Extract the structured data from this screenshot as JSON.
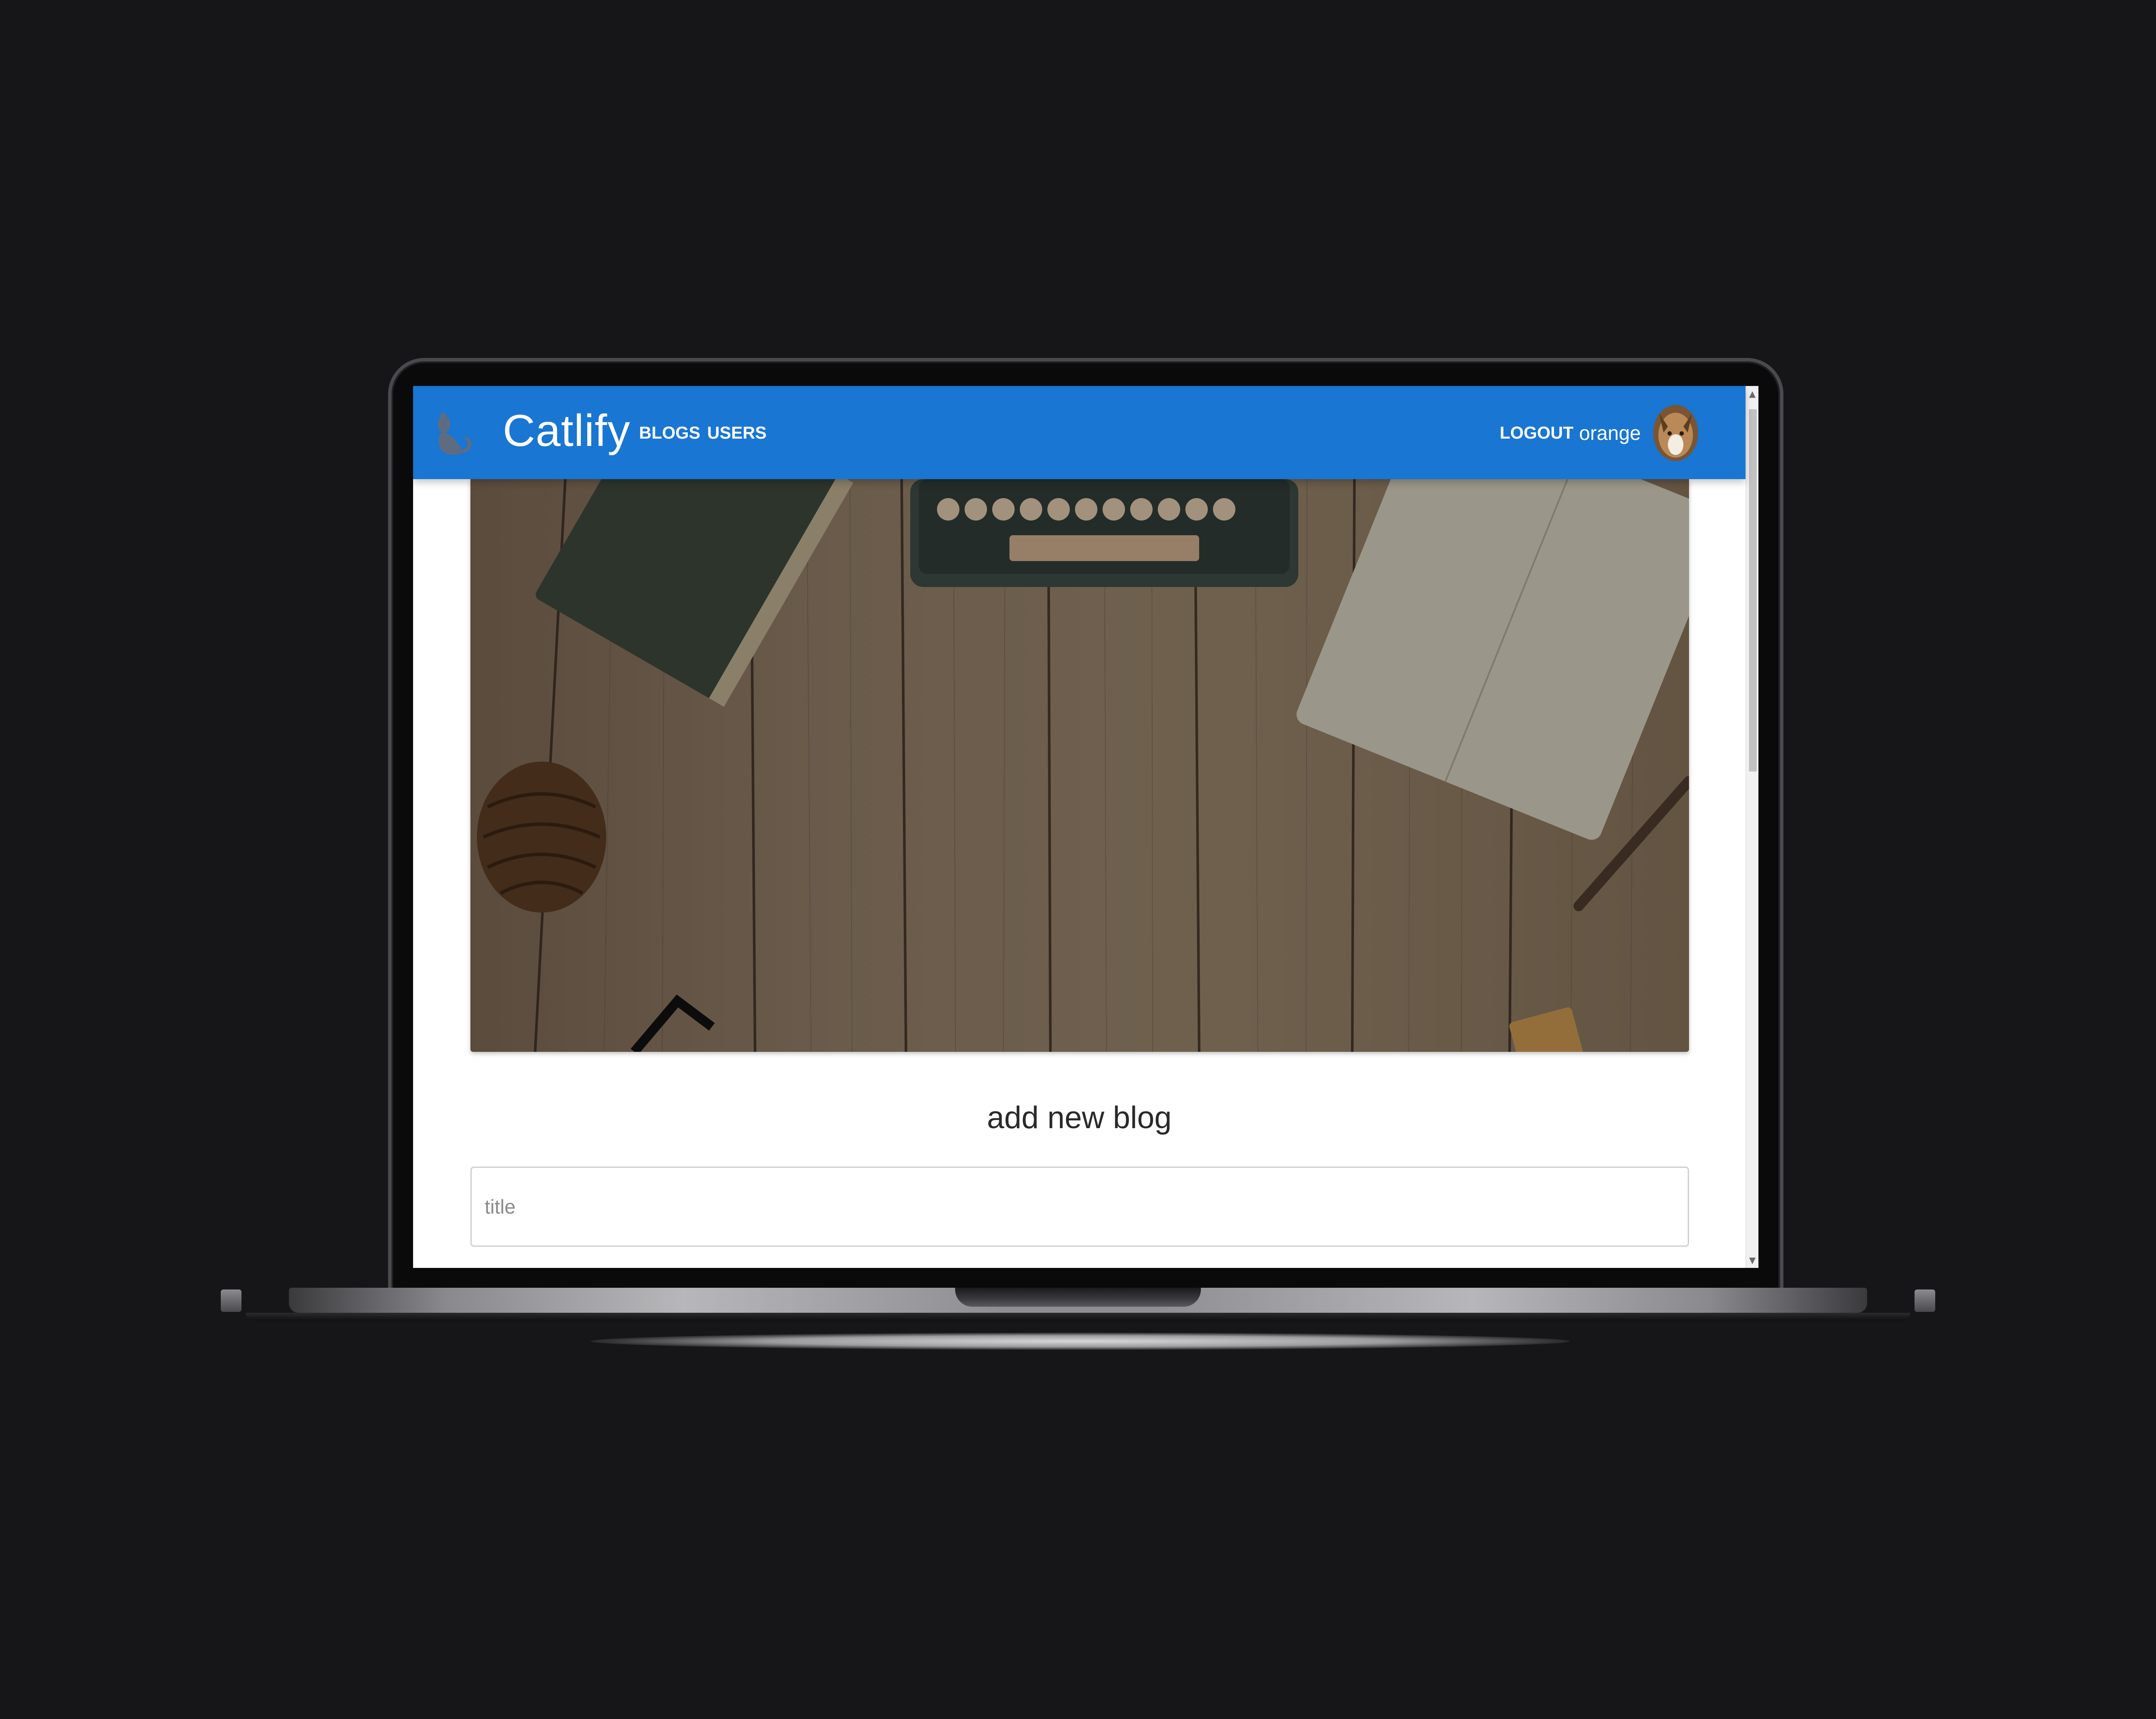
{
  "app": {
    "brand": "Catlify",
    "accent_color": "#1976d2"
  },
  "nav": {
    "blogs_label": "BLOGS",
    "users_label": "USERS",
    "logout_label": "LOGOUT",
    "username": "orange"
  },
  "icons": {
    "logo": "cat-icon",
    "avatar": "user-avatar"
  },
  "form": {
    "heading": "add new blog",
    "title_placeholder": "title",
    "title_value": ""
  },
  "device": {
    "frame": "laptop-mockup"
  }
}
